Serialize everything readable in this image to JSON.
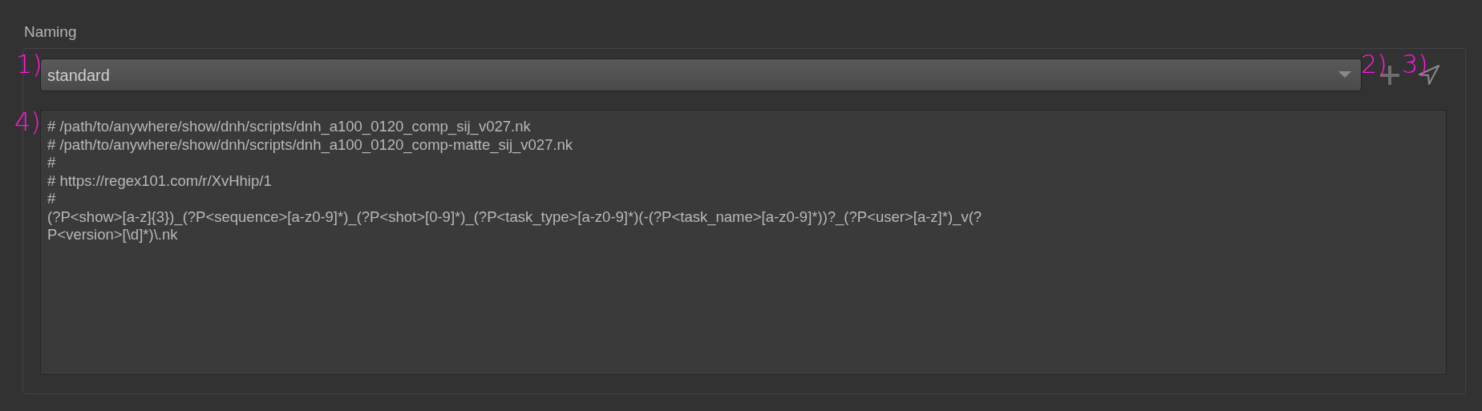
{
  "group": {
    "title": "Naming"
  },
  "preset_dropdown": {
    "value": "standard"
  },
  "toolbar": [
    {
      "kind": "add"
    },
    {
      "kind": "send"
    }
  ],
  "pattern_editor": {
    "lines": [
      "# /path/to/anywhere/show/dnh/scripts/dnh_a100_0120_comp_sij_v027.nk",
      "# /path/to/anywhere/show/dnh/scripts/dnh_a100_0120_comp-matte_sij_v027.nk",
      "#",
      "# https://regex101.com/r/XvHhip/1",
      "#",
      "(?P<show>[a-z]{3})_(?P<sequence>[a-z0-9]*)_(?P<shot>[0-9]*)_(?P<task_type>[a-z0-9]*)(-(?P<task_name>[a-z0-9]*))?_(?P<user>[a-z]*)_v(?",
      "P<version>[\\d]*)\\.nk"
    ]
  },
  "annotations": [
    {
      "label": "1)"
    },
    {
      "label": "2)"
    },
    {
      "label": "3)"
    },
    {
      "label": "4)"
    }
  ]
}
